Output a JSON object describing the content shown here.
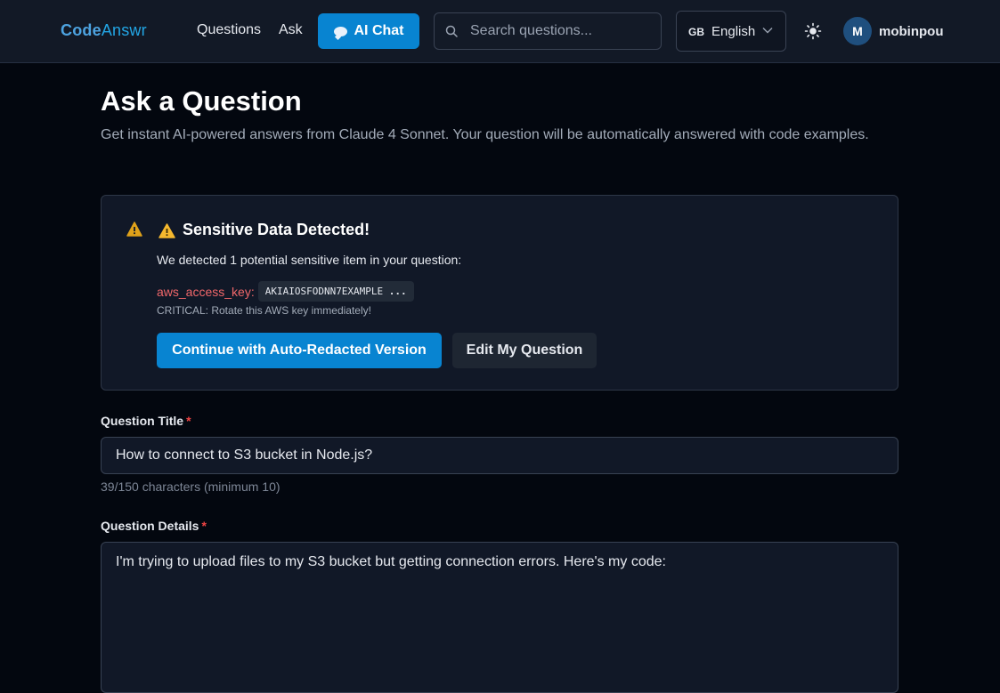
{
  "header": {
    "logo_code": "Code",
    "logo_answr": "Answr",
    "nav": {
      "questions": "Questions",
      "ask": "Ask"
    },
    "ai_chat_label": "AI Chat",
    "search_placeholder": "Search questions...",
    "language": {
      "flag": "GB",
      "label": "English"
    },
    "user": {
      "initial": "M",
      "name": "mobinpou"
    }
  },
  "main": {
    "title": "Ask a Question",
    "subtitle": "Get instant AI-powered answers from Claude 4 Sonnet. Your question will be automatically answered with code examples."
  },
  "alert": {
    "title": "Sensitive Data Detected!",
    "description": "We detected 1 potential sensitive item in your question:",
    "items": [
      {
        "type": "aws_access_key:",
        "value": "AKIAIOSFODNN7EXAMPLE",
        "ellipsis": "...",
        "note": "CRITICAL: Rotate this AWS key immediately!"
      }
    ],
    "continue_label": "Continue with Auto-Redacted Version",
    "edit_label": "Edit My Question"
  },
  "form": {
    "title_label": "Question Title",
    "required_marker": "*",
    "title_value": "How to connect to S3 bucket in Node.js?",
    "char_count": "39/150 characters (minimum 10)",
    "details_label": "Question Details",
    "details_value": "I'm trying to upload files to my S3 bucket but getting connection errors. Here's my code:"
  },
  "colors": {
    "accent": "#0884d1",
    "warning": "#f5a623",
    "danger": "#ef4444",
    "background": "#03070f"
  },
  "icons": [
    "search-icon",
    "chevron-down-icon",
    "sun-icon",
    "warning-icon",
    "chat-bubble-icon"
  ]
}
